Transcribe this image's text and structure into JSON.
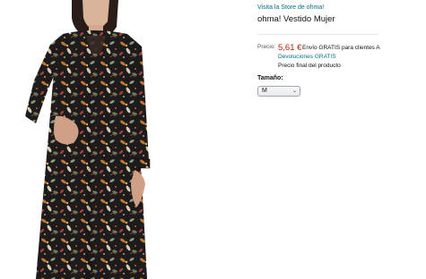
{
  "product": {
    "store_link": "Visita la Store de ohma!",
    "title": "ohma! Vestido Mujer",
    "image_alt_icon": "dress-photo",
    "price_label": "Precio:",
    "price": "5,61 €",
    "shipping": "Envío GRATIS para clientes A",
    "returns": "Devoluciones GRATIS",
    "final_price_note": "Precio final del producto",
    "size_label": "Tamaño:",
    "size_selected": "M"
  },
  "colors": {
    "link": "#007185",
    "price": "#b12704",
    "dress_base": "#1e1b1d",
    "text": "#0f1111"
  }
}
